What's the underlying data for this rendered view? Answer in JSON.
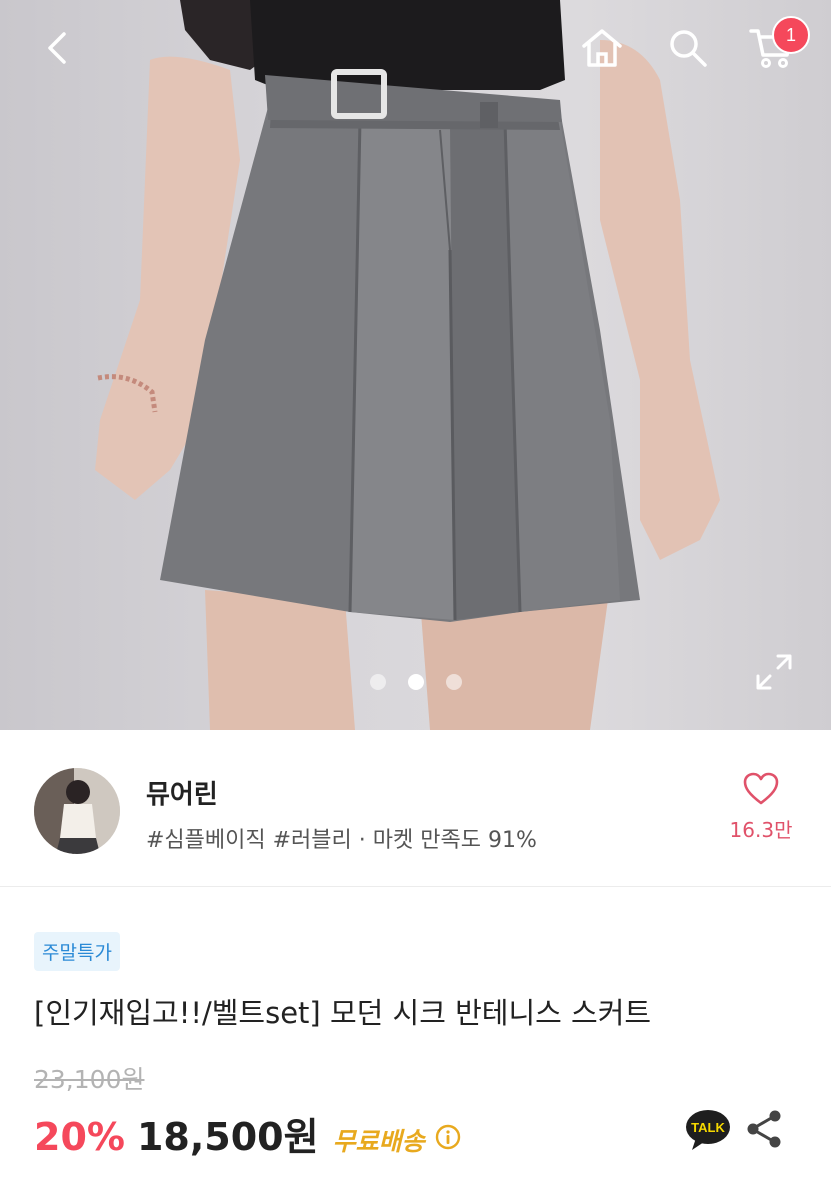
{
  "header": {
    "back_icon": "chevron-left-icon",
    "home_icon": "home-icon",
    "search_icon": "search-icon",
    "cart_icon": "cart-icon",
    "cart_count": "1"
  },
  "gallery": {
    "image_count": 3,
    "active_index": 1,
    "expand_icon": "expand-icon"
  },
  "shop": {
    "name": "뮤어린",
    "tags": "#심플베이직 #러블리 · 마켓 만족도 91%",
    "like_count": "16.3만",
    "like_icon": "heart-outline-icon"
  },
  "product": {
    "badge": "주말특가",
    "title": "[인기재입고!!/벨트set] 모던 시크 반테니스 스커트",
    "original_price": "23,100원",
    "discount": "20%",
    "price": "18,500원",
    "shipping": "무료배송",
    "info_icon": "info-circle-icon",
    "talk_label": "TALK",
    "share_icon": "share-icon"
  },
  "colors": {
    "accent_red": "#f5485b",
    "badge_blue": "#2b8ad6",
    "shipping_yellow": "#e8a91e"
  }
}
